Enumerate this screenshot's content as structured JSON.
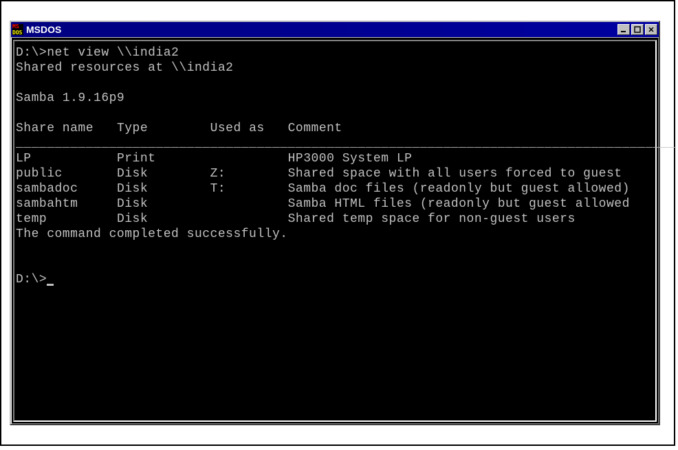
{
  "window": {
    "title": "MSDOS",
    "icon": "msdos-icon"
  },
  "terminal": {
    "prompt1": "D:\\>",
    "command": "net view \\\\india2",
    "response_header": "Shared resources at \\\\india2",
    "server_info": "Samba 1.9.16p9",
    "columns": {
      "c1": "Share name",
      "c2": "Type",
      "c3": "Used as",
      "c4": "Comment"
    },
    "divider": "_____________________________________________________________________________________",
    "rows": [
      {
        "share": "LP",
        "type": "Print",
        "used": "",
        "comment": "HP3000 System LP"
      },
      {
        "share": "public",
        "type": "Disk",
        "used": "Z:",
        "comment": "Shared space with all users forced to guest"
      },
      {
        "share": "sambadoc",
        "type": "Disk",
        "used": "T:",
        "comment": "Samba doc files (readonly but guest allowed)"
      },
      {
        "share": "sambahtm",
        "type": "Disk",
        "used": "",
        "comment": "Samba HTML files (readonly but guest allowed"
      },
      {
        "share": "temp",
        "type": "Disk",
        "used": "",
        "comment": "Shared temp space for non-guest users"
      }
    ],
    "completion": "The command completed successfully.",
    "prompt2": "D:\\>"
  }
}
